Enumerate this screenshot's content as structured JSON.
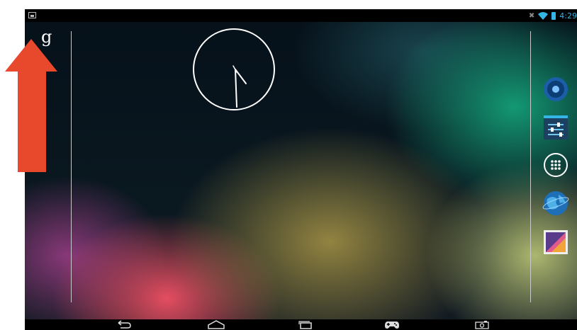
{
  "status_bar": {
    "time": "4:29"
  },
  "home": {
    "search_letter": "g"
  },
  "dock": [
    {
      "name": "music-app-icon"
    },
    {
      "name": "settings-app-icon"
    },
    {
      "name": "all-apps-icon"
    },
    {
      "name": "browser-app-icon"
    },
    {
      "name": "gallery-app-icon"
    }
  ],
  "nav": [
    "back",
    "home",
    "recent-apps",
    "game-controller",
    "screenshot"
  ],
  "colors": {
    "accent": "#33b5e5",
    "arrow": "#e8482c",
    "nav_bg": "#000000"
  }
}
